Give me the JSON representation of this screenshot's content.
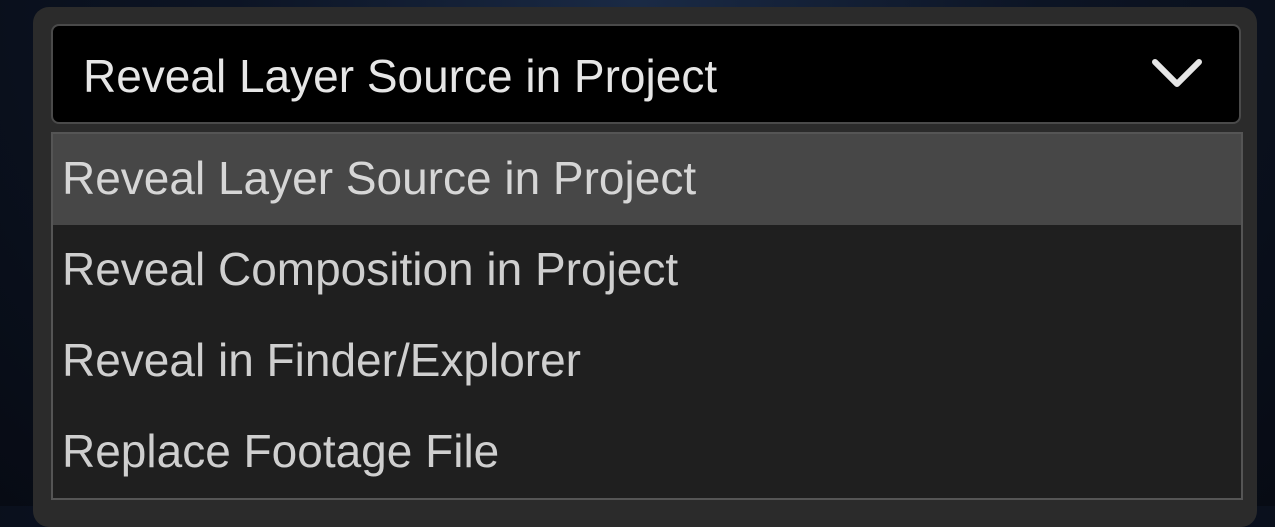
{
  "dropdown": {
    "selected_value": "Reveal Layer Source in Project",
    "chevron_icon": "chevron-down-icon",
    "options": [
      {
        "label": "Reveal Layer Source in Project",
        "highlighted": true
      },
      {
        "label": "Reveal Composition in Project",
        "highlighted": false
      },
      {
        "label": "Reveal in Finder/Explorer",
        "highlighted": false
      },
      {
        "label": "Replace Footage File",
        "highlighted": false
      }
    ]
  },
  "colors": {
    "panel_bg": "#2b2b2b",
    "select_bg": "#000000",
    "menu_bg": "#1f1f1f",
    "highlight_bg": "#474747",
    "text": "#cfcfcf"
  }
}
